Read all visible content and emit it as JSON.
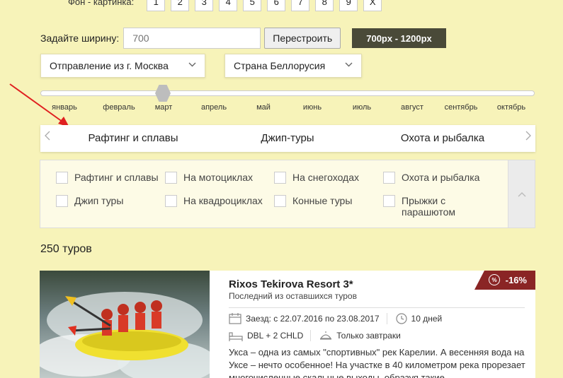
{
  "bg_selector": {
    "label": "Фон - картинка:",
    "options": [
      "1",
      "2",
      "3",
      "4",
      "5",
      "6",
      "7",
      "8",
      "9",
      "X"
    ]
  },
  "width_control": {
    "label": "Задайте ширину:",
    "placeholder": "700",
    "button": "Перестроить",
    "range_badge": "700px - 1200px"
  },
  "selects": {
    "departure": "Отправление из г. Москва",
    "country": "Страна Беллорусия"
  },
  "months": [
    "январь",
    "февраль",
    "март",
    "апрель",
    "май",
    "июнь",
    "июль",
    "август",
    "сентябрь",
    "октябрь"
  ],
  "selected_month": "март",
  "tabs": [
    "Рафтинг и сплавы",
    "Джип-туры",
    "Охота и рыбалка"
  ],
  "filters": [
    [
      "Рафтинг и сплавы",
      "На мотоциклах",
      "На снегоходах",
      "Охота и рыбалка"
    ],
    [
      "Джип туры",
      "На квадроциклах",
      "Конные туры",
      "Прыжки с парашютом"
    ]
  ],
  "tours_count": "250 туров",
  "card": {
    "title": "Rixos Tekirova Resort 3*",
    "subtitle": "Последний из оставшихся туров",
    "discount": "-16%",
    "discount_icon": "%",
    "dates": "Заезд: с 22.07.2016 по 23.08.2017",
    "duration": "10 дней",
    "room": "DBL + 2 CHLD",
    "meals": "Только завтраки",
    "description": "Укса – одна из самых \"спортивных\" рек Карелии. А весенняя вода на Уксе – нечто особенное! На участке в 40 километром река прорезает многочисленные скальные выходы, образуя такие"
  },
  "colors": {
    "background": "#f7f3b9",
    "badge": "#4a4a38",
    "discount": "#8a2525",
    "annotation_arrow": "#e02020"
  }
}
